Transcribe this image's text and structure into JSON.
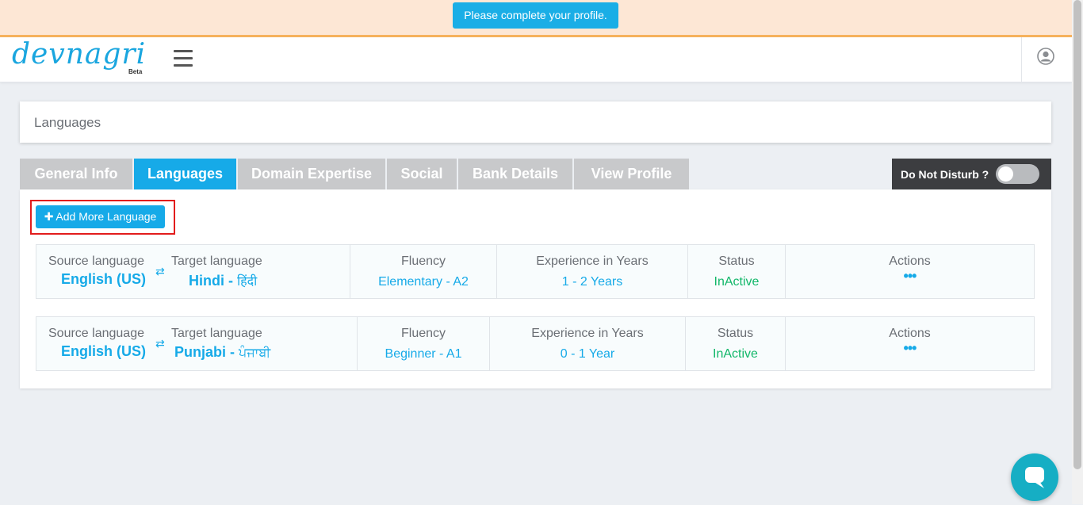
{
  "notice": {
    "text": "Please complete your profile."
  },
  "brand": {
    "logo_text": "devnagri",
    "badge": "Beta"
  },
  "icons": {
    "menu": "hamburger-icon",
    "user": "user-circle-icon",
    "swap": "swap-arrows-icon",
    "more": "more-dots-icon",
    "chat": "chat-bubble-icon",
    "add": "plus-icon"
  },
  "colors": {
    "accent": "#16aae8",
    "status_green": "#12b76a",
    "notice_bg": "#fde7d5",
    "highlight": "#e21c1c"
  },
  "page": {
    "title": "Languages"
  },
  "tabs": [
    {
      "label": "General Info",
      "active": false
    },
    {
      "label": "Languages",
      "active": true
    },
    {
      "label": "Domain Expertise",
      "active": false
    },
    {
      "label": "Social",
      "active": false
    },
    {
      "label": "Bank Details",
      "active": false
    },
    {
      "label": "View Profile",
      "active": false
    }
  ],
  "dnd": {
    "label": "Do Not Disturb ?",
    "enabled": false
  },
  "add_button": {
    "label": "Add More Language"
  },
  "headers": {
    "source": "Source language",
    "target": "Target language",
    "fluency": "Fluency",
    "experience": "Experience in Years",
    "status": "Status",
    "actions": "Actions"
  },
  "languages": [
    {
      "source": "English (US)",
      "target": "Hindi",
      "target_native": "हिंदी",
      "fluency": "Elementary - A2",
      "experience": "1 - 2 Years",
      "status": "InActive",
      "actions": "•••"
    },
    {
      "source": "English (US)",
      "target": "Punjabi",
      "target_native": "ਪੰਜਾਬੀ",
      "fluency": "Beginner - A1",
      "experience": "0 - 1 Year",
      "status": "InActive",
      "actions": "•••"
    }
  ]
}
